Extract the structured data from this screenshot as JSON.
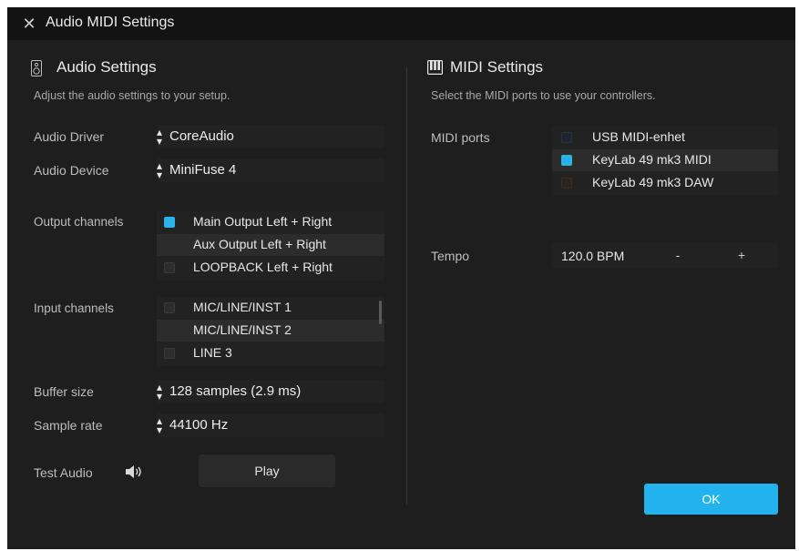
{
  "window": {
    "title": "Audio MIDI Settings",
    "close_icon": "close-icon"
  },
  "audio": {
    "title": "Audio Settings",
    "subtitle": "Adjust the audio settings to your setup.",
    "driver_label": "Audio Driver",
    "driver_value": "CoreAudio",
    "device_label": "Audio Device",
    "device_value": "MiniFuse 4",
    "output_label": "Output channels",
    "output_channels": [
      {
        "label": "Main Output Left + Right",
        "checked": true
      },
      {
        "label": "Aux Output Left + Right",
        "checked": false
      },
      {
        "label": "LOOPBACK Left + Right",
        "checked": false
      }
    ],
    "input_label": "Input channels",
    "input_channels": [
      {
        "label": "MIC/LINE/INST 1",
        "checked": false
      },
      {
        "label": "MIC/LINE/INST 2",
        "checked": false
      },
      {
        "label": "LINE 3",
        "checked": false
      }
    ],
    "buffer_label": "Buffer size",
    "buffer_value": "128 samples (2.9 ms)",
    "rate_label": "Sample rate",
    "rate_value": "44100 Hz",
    "test_label": "Test Audio",
    "play_label": "Play"
  },
  "midi": {
    "title": "MIDI Settings",
    "subtitle": "Select the MIDI ports to use your controllers.",
    "ports_label": "MIDI ports",
    "ports": [
      {
        "label": "USB MIDI-enhet",
        "checked": false
      },
      {
        "label": "KeyLab 49 mk3 MIDI",
        "checked": true
      },
      {
        "label": "KeyLab 49 mk3 DAW",
        "checked": false
      }
    ],
    "tempo_label": "Tempo",
    "tempo_value": "120.0 BPM",
    "tempo_minus": "-",
    "tempo_plus": "+"
  },
  "ok_label": "OK",
  "colors": {
    "accent": "#29b3e6",
    "background": "#1e1e1e",
    "titlebar": "#131313"
  }
}
